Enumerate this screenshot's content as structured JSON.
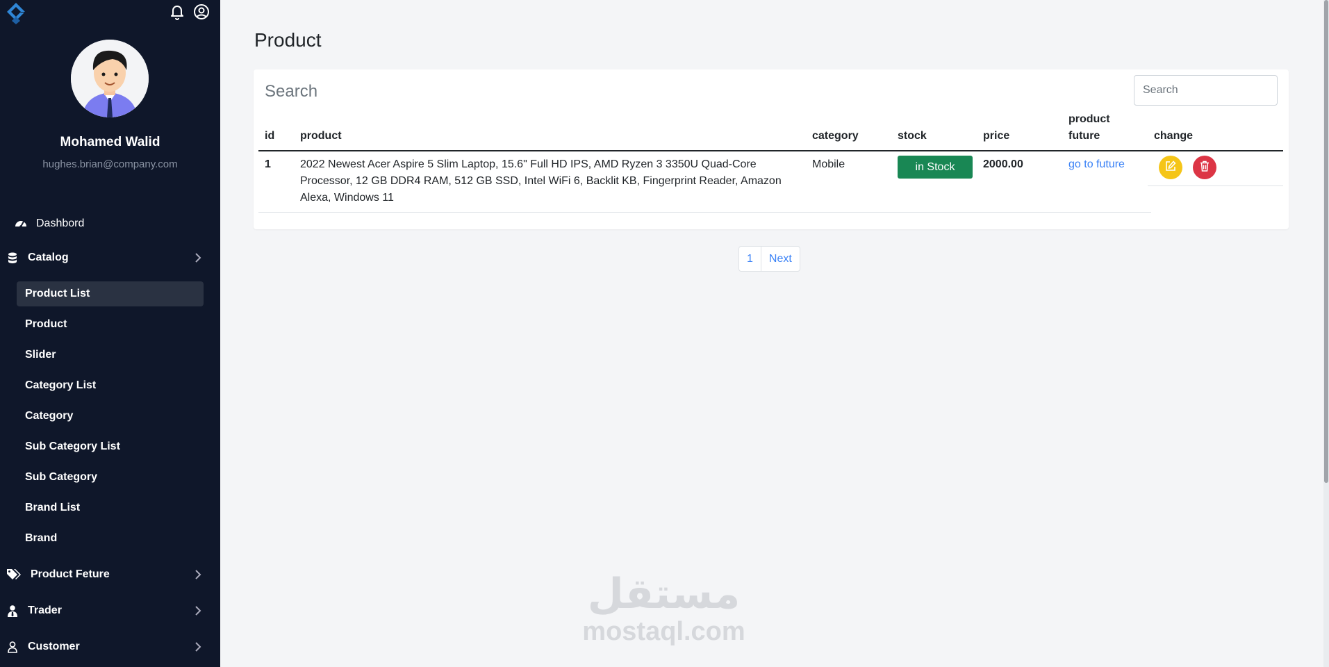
{
  "user": {
    "name": "Mohamed Walid",
    "email": "hughes.brian@company.com"
  },
  "sidebar": {
    "dashboard": "Dashbord",
    "catalog": "Catalog",
    "catalog_items": [
      "Product List",
      "Product",
      "Slider",
      "Category List",
      "Category",
      "Sub Category List",
      "Sub Category",
      "Brand List",
      "Brand"
    ],
    "product_feature": "Product Feture",
    "trader": "Trader",
    "customer": "Customer"
  },
  "page": {
    "title": "Product",
    "card_title": "Search",
    "search_placeholder": "Search"
  },
  "table": {
    "headers": {
      "id": "id",
      "product": "product",
      "category": "category",
      "stock": "stock",
      "price": "price",
      "product_future_1": "product",
      "product_future_2": "future",
      "change": "change"
    },
    "rows": [
      {
        "id": "1",
        "product": "2022 Newest Acer Aspire 5 Slim Laptop, 15.6\" Full HD IPS, AMD Ryzen 3 3350U Quad-Core Processor, 12 GB DDR4 RAM, 512 GB SSD, Intel WiFi 6, Backlit KB, Fingerprint Reader, Amazon Alexa, Windows 11",
        "category": "Mobile",
        "stock": "in Stock",
        "price": "2000.00",
        "future_link": "go to future"
      }
    ]
  },
  "pagination": {
    "page": "1",
    "next": "Next"
  },
  "watermark": {
    "arabic": "مستقل",
    "latin": "mostaql.com"
  },
  "colors": {
    "sidebar_bg": "#0f172a",
    "stock_green": "#198754",
    "edit_yellow": "#f5c518",
    "delete_red": "#dc3545",
    "link_blue": "#3b82f6"
  }
}
